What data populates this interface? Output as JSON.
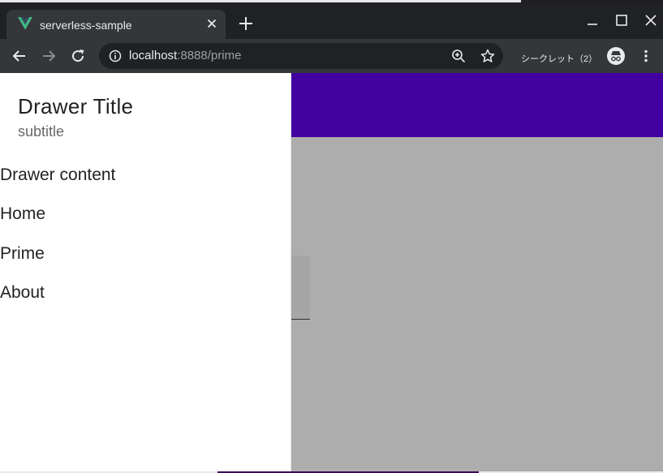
{
  "browser": {
    "tab": {
      "title": "serverless-sample"
    },
    "address_bar": {
      "host": "localhost",
      "path": ":8888/prime"
    },
    "incognito": {
      "label": "シークレット（2）"
    }
  },
  "drawer": {
    "title": "Drawer Title",
    "subtitle": "subtitle",
    "content_label": "Drawer content",
    "nav": [
      {
        "label": "Home"
      },
      {
        "label": "Prime"
      },
      {
        "label": "About"
      }
    ]
  },
  "colors": {
    "app_bar": "#6200ee",
    "vue_logo_green": "#41b883",
    "vue_logo_dark": "#35495e",
    "browser_frame": "#202124",
    "browser_toolbar": "#35363a"
  },
  "icons": [
    "vue-logo-icon",
    "close-icon",
    "plus-icon",
    "minimize-icon",
    "maximize-icon",
    "window-close-icon",
    "back-icon",
    "forward-icon",
    "reload-icon",
    "info-icon",
    "zoom-icon",
    "star-icon",
    "incognito-icon",
    "more-vert-icon"
  ]
}
